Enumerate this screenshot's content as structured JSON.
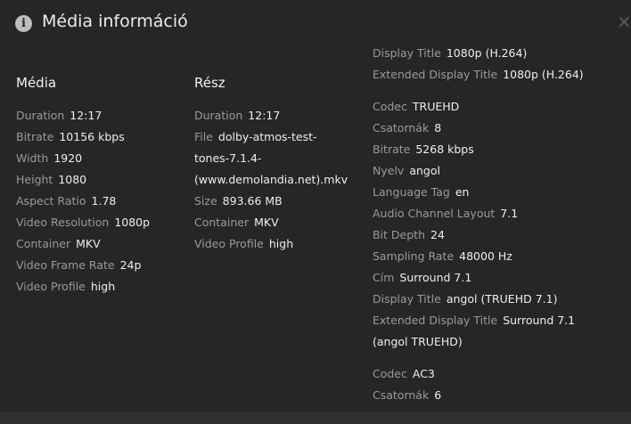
{
  "dialog": {
    "title": "Média információ",
    "info_icon": "info-icon",
    "close_icon": "close-icon",
    "close_glyph": "×",
    "info_glyph": "i"
  },
  "media": {
    "heading": "Média",
    "rows": [
      {
        "label": "Duration",
        "value": "12:17"
      },
      {
        "label": "Bitrate",
        "value": "10156 kbps"
      },
      {
        "label": "Width",
        "value": "1920"
      },
      {
        "label": "Height",
        "value": "1080"
      },
      {
        "label": "Aspect Ratio",
        "value": "1.78"
      },
      {
        "label": "Video Resolution",
        "value": "1080p"
      },
      {
        "label": "Container",
        "value": "MKV"
      },
      {
        "label": "Video Frame Rate",
        "value": "24p"
      },
      {
        "label": "Video Profile",
        "value": "high"
      }
    ]
  },
  "part": {
    "heading": "Rész",
    "rows": [
      {
        "label": "Duration",
        "value": "12:17"
      },
      {
        "label": "File",
        "value": "dolby-atmos-test-tones-7.1.4-(www.demolandia.net).mkv"
      },
      {
        "label": "Size",
        "value": "893.66 MB"
      },
      {
        "label": "Container",
        "value": "MKV"
      },
      {
        "label": "Video Profile",
        "value": "high"
      }
    ]
  },
  "streams": {
    "video_tail": [
      {
        "label": "Display Title",
        "value": "1080p (H.264)"
      },
      {
        "label": "Extended Display Title",
        "value": "1080p (H.264)"
      }
    ],
    "audio_1": [
      {
        "label": "Codec",
        "value": "TRUEHD"
      },
      {
        "label": "Csatornák",
        "value": "8"
      },
      {
        "label": "Bitrate",
        "value": "5268 kbps"
      },
      {
        "label": "Nyelv",
        "value": "angol"
      },
      {
        "label": "Language Tag",
        "value": "en"
      },
      {
        "label": "Audio Channel Layout",
        "value": "7.1"
      },
      {
        "label": "Bit Depth",
        "value": "24"
      },
      {
        "label": "Sampling Rate",
        "value": "48000 Hz"
      },
      {
        "label": "Cím",
        "value": "Surround 7.1"
      },
      {
        "label": "Display Title",
        "value": "angol (TRUEHD 7.1)"
      },
      {
        "label": "Extended Display Title",
        "value": "Surround 7.1 (angol TRUEHD)"
      }
    ],
    "audio_2": [
      {
        "label": "Codec",
        "value": "AC3"
      },
      {
        "label": "Csatornák",
        "value": "6"
      }
    ]
  }
}
